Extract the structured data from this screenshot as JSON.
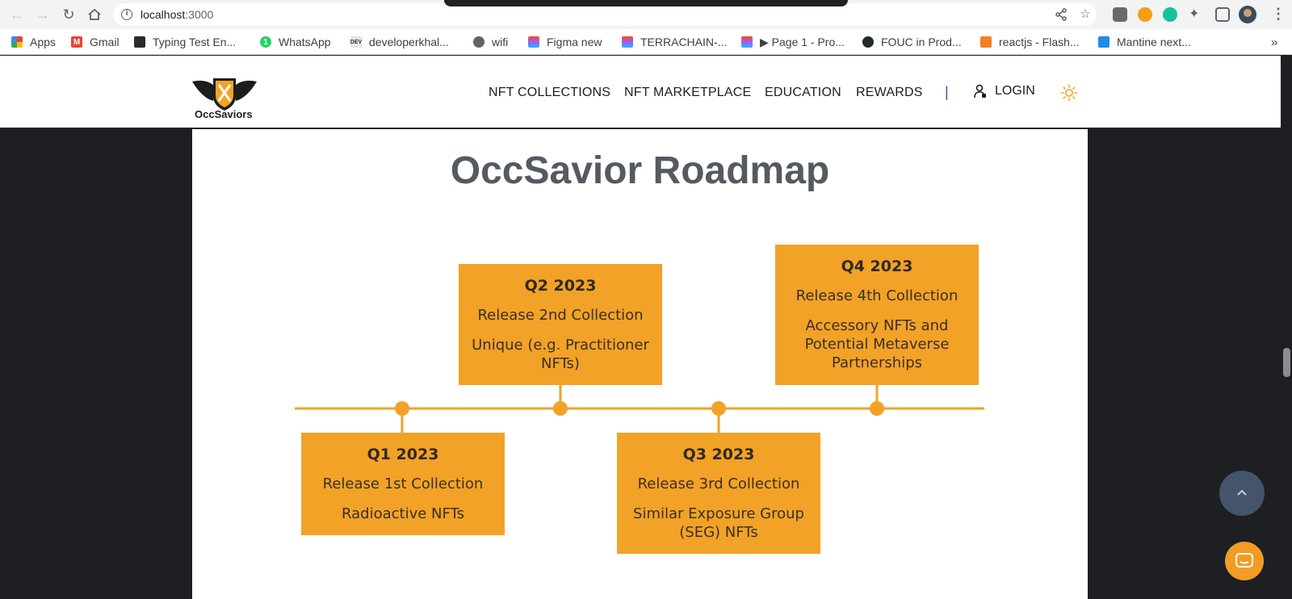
{
  "browser": {
    "url_host": "localhost",
    "url_port": ":3000",
    "bookmarks": [
      "Apps",
      "Gmail",
      "Typing Test En...",
      "WhatsApp",
      "developerkhal...",
      "wifi",
      "Figma new",
      "TERRACHAIN-...",
      "▶ Page 1 - Pro...",
      "FOUC in Prod...",
      "reactjs - Flash...",
      "Mantine next..."
    ],
    "bookmarks_more": "»"
  },
  "site": {
    "logo_text": "OccSaviors",
    "nav": [
      "NFT COLLECTIONS",
      "NFT MARKETPLACE",
      "EDUCATION",
      "REWARDS"
    ],
    "separator": "|",
    "login": "LOGIN"
  },
  "roadmap": {
    "title": "OccSavior Roadmap",
    "items": [
      {
        "quarter": "Q1 2023",
        "line1": "Release 1st Collection",
        "line2": "Radioactive NFTs"
      },
      {
        "quarter": "Q2 2023",
        "line1": "Release 2nd Collection",
        "line2": "Unique (e.g. Practitioner NFTs)"
      },
      {
        "quarter": "Q3 2023",
        "line1": "Release 3rd Collection",
        "line2": "Similar Exposure Group (SEG) NFTs"
      },
      {
        "quarter": "Q4 2023",
        "line1": "Release 4th Collection",
        "line2": "Accessory NFTs and Potential Metaverse Partnerships"
      }
    ]
  },
  "colors": {
    "accent": "#f2a227",
    "page_bg": "#1d1f23",
    "title": "#555a61",
    "fab": "#44546a"
  },
  "icons": [
    "back-icon",
    "forward-icon",
    "reload-icon",
    "home-icon",
    "info-icon",
    "share-icon",
    "star-icon",
    "extensions-icon",
    "user-icon",
    "sun-icon",
    "chevron-up-icon",
    "chat-icon"
  ]
}
